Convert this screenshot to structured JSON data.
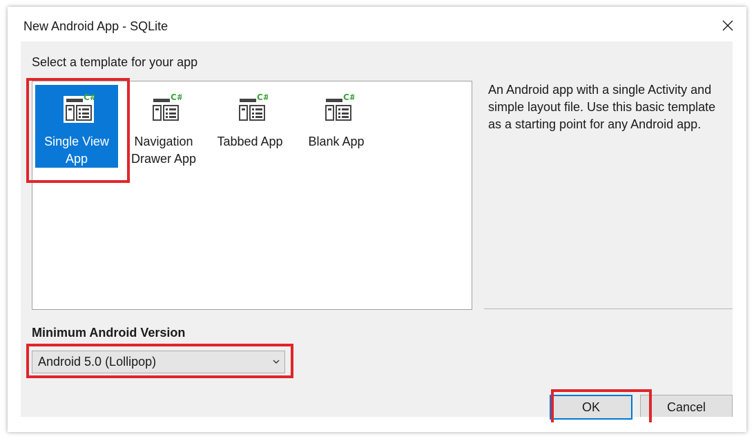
{
  "window": {
    "title": "New Android App - SQLite"
  },
  "prompt": "Select a template for your app",
  "templates": [
    {
      "label_line1": "Single View",
      "label_line2": "App",
      "selected": true
    },
    {
      "label_line1": "Navigation",
      "label_line2": "Drawer App",
      "selected": false
    },
    {
      "label_line1": "Tabbed App",
      "label_line2": "",
      "selected": false
    },
    {
      "label_line1": "Blank App",
      "label_line2": "",
      "selected": false
    }
  ],
  "icon_badge": "C#",
  "description": "An Android app with a single Activity and simple layout file. Use this basic template as a starting point for any Android app.",
  "min_version": {
    "label": "Minimum Android Version",
    "selected": "Android 5.0 (Lollipop)"
  },
  "buttons": {
    "ok": "OK",
    "cancel": "Cancel"
  },
  "colors": {
    "selection": "#0a78d7",
    "highlight": "#e0252b",
    "csharp_badge": "#3fa33c"
  }
}
